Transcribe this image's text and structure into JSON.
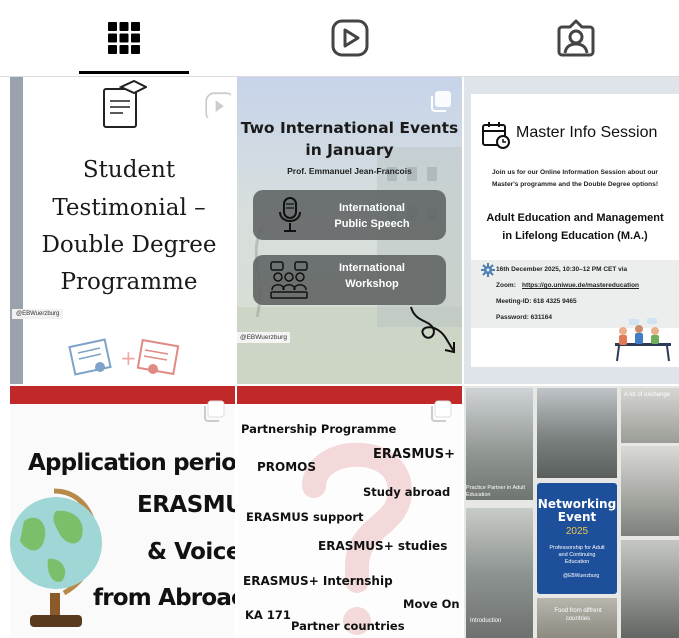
{
  "tabs": [
    {
      "name": "tab-posts",
      "icon": "grid-icon",
      "active": true
    },
    {
      "name": "tab-reels",
      "icon": "reels-play-icon",
      "active": false
    },
    {
      "name": "tab-tagged",
      "icon": "tagged-person-icon",
      "active": false
    }
  ],
  "posts": {
    "p1": {
      "title_lines": [
        "Student",
        "Testimonial –",
        "Double Degree",
        "Programme"
      ],
      "handle": "@EBWuerzburg"
    },
    "p2": {
      "title_lines": [
        "Two International Events",
        "in January"
      ],
      "author": "Prof. Emmanuel Jean-Francois",
      "event1_lines": [
        "International",
        "Public Speech"
      ],
      "event2_lines": [
        "International",
        "Workshop"
      ],
      "handle": "@EBWuerzburg"
    },
    "p3": {
      "title": "Master Info Session",
      "intro_lines": [
        "Join us for our Online Information Session about our",
        "Master's programme and the Double Degree options!"
      ],
      "program_lines": [
        "Adult Education and Management",
        "in Lifelong Education (M.A.)"
      ],
      "date": "16th December 2025, 10:30–12 PM CET via",
      "zoom_label": "Zoom:",
      "zoom_link": "https://go.uniwue.de/mastereducation",
      "meeting_id": "Meeting-ID: 618 4325 9465",
      "password": "Password: 631164"
    },
    "p4": {
      "lines": [
        "Application perioc",
        "ERASMU!",
        "& Voice!",
        "from Abroac"
      ]
    },
    "p5": {
      "words": [
        "Partnership Programme",
        "ERASMUS+",
        "PROMOS",
        "Study abroad",
        "ERASMUS support",
        "ERASMUS+ studies",
        "ERASMUS+ Internship",
        "Move On",
        "KA 171",
        "Partner countries"
      ]
    },
    "p6": {
      "title_lines": [
        "Networking",
        "Event"
      ],
      "year": "2025",
      "subtitle_lines": [
        "Professorship for Adult",
        "and Continuing",
        "Education"
      ],
      "handle": "@EBWuerzburg",
      "captions": [
        "A lot of exchange",
        "Practice Partner in Adult Education",
        "Introduction",
        "Food from diffrent countries"
      ]
    }
  },
  "colors": {
    "red_banner": "#c0282a",
    "navy": "#1f3a5a",
    "networking_blue": "#1d4f9a",
    "tag_bg": "#5a5a5a"
  }
}
